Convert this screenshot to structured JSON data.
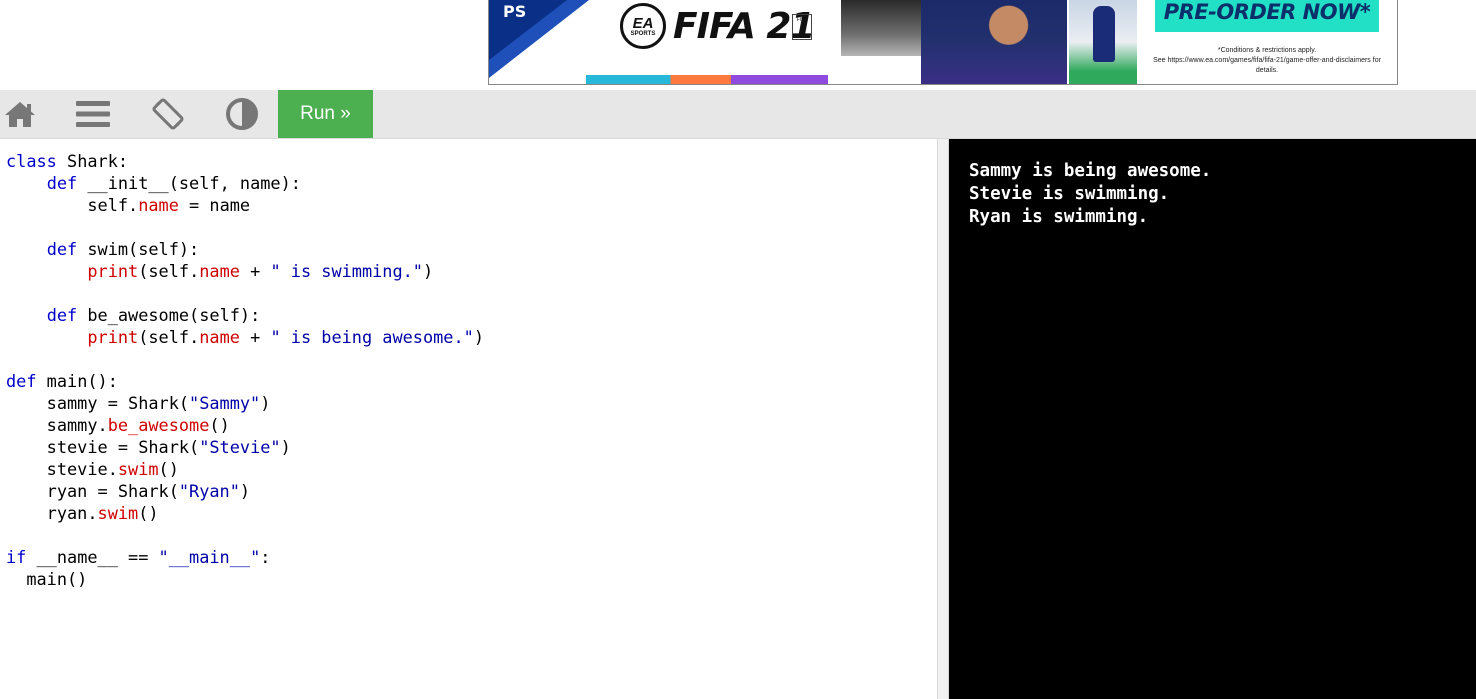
{
  "ad": {
    "platform_logo": "PS",
    "publisher_badge_top": "EA",
    "publisher_badge_bottom": "SPORTS",
    "game_title": "FIFA 21",
    "rating_box": "FIFA",
    "cta": "PRE-ORDER NOW*",
    "disclaimer_line1": "*Conditions & restrictions apply.",
    "disclaimer_line2": "See https://www.ea.com/games/fifa/fifa-21/game-offer-and-disclaimers for details."
  },
  "toolbar": {
    "home_icon": "home-icon",
    "menu_icon": "menu-icon",
    "rotate_icon": "rotate-layout-icon",
    "theme_icon": "contrast-icon",
    "run_label": "Run »",
    "run_color": "#4caf50"
  },
  "editor": {
    "language": "python",
    "lines": [
      "class Shark:",
      "    def __init__(self, name):",
      "        self.name = name",
      "",
      "    def swim(self):",
      "        print(self.name + \" is swimming.\")",
      "",
      "    def be_awesome(self):",
      "        print(self.name + \" is being awesome.\")",
      "",
      "def main():",
      "    sammy = Shark(\"Sammy\")",
      "    sammy.be_awesome()",
      "    stevie = Shark(\"Stevie\")",
      "    stevie.swim()",
      "    ryan = Shark(\"Ryan\")",
      "    ryan.swim()",
      "",
      "if __name__ == \"__main__\":",
      "  main()"
    ]
  },
  "output": {
    "lines": [
      "Sammy is being awesome.",
      "Stevie is swimming.",
      "Ryan is swimming."
    ],
    "background": "#000000",
    "text_color": "#ffffff"
  }
}
